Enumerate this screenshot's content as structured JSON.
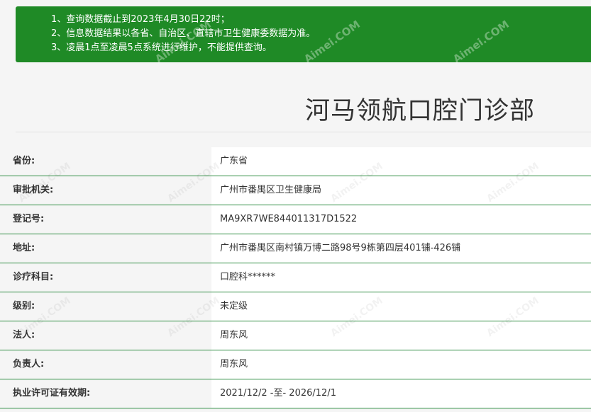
{
  "notice": {
    "lines": [
      "1、查询数据截止到2023年4月30日22时；",
      "2、信息数据结果以各省、自治区、直辖市卫生健康委数据为准。",
      "3、凌晨1点至凌晨5点系统进行维护，不能提供查询。"
    ],
    "background_color": "#1f8a26"
  },
  "clinic": {
    "name": "河马领航口腔门诊部"
  },
  "rows": [
    {
      "label": "省份:",
      "value": "广东省"
    },
    {
      "label": "审批机关:",
      "value": "广州市番禺区卫生健康局"
    },
    {
      "label": "登记号:",
      "value": "MA9XR7WE844011317D1522"
    },
    {
      "label": "地址:",
      "value": "广州市番禺区南村镇万博二路98号9栋第四层401铺-426铺"
    },
    {
      "label": "诊疗科目:",
      "value": "口腔科******"
    },
    {
      "label": "级别:",
      "value": "未定级"
    },
    {
      "label": "法人:",
      "value": "周东风"
    },
    {
      "label": "负责人:",
      "value": "周东风"
    },
    {
      "label": "执业许可证有效期:",
      "value": "2021/12/2 -至- 2026/12/1"
    }
  ],
  "watermark": {
    "text": "Aimei.COM"
  },
  "accent_color": "#2d8c41"
}
